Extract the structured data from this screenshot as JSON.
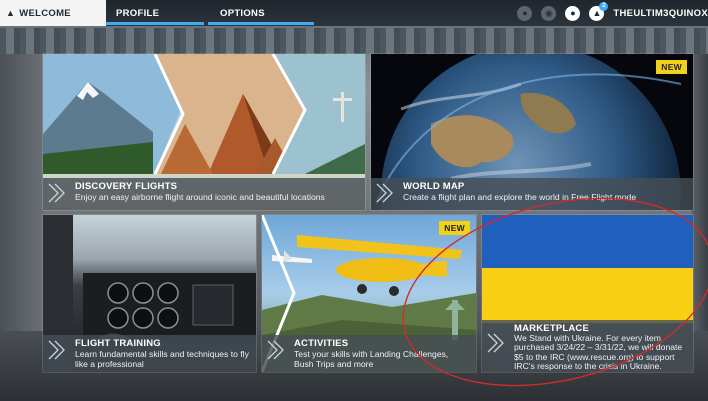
{
  "nav": {
    "tabs": [
      {
        "label": "WELCOME",
        "active": true
      },
      {
        "label": "PROFILE",
        "active": false
      },
      {
        "label": "OPTIONS",
        "active": false
      }
    ],
    "username": "THEULTIM3QUINOX",
    "notification_count": "2",
    "icons": [
      "globe-icon",
      "friends-icon",
      "user-icon",
      "notifications-icon"
    ]
  },
  "tiles": {
    "discovery": {
      "title": "DISCOVERY FLIGHTS",
      "description": "Enjoy an easy airborne flight around iconic and beautiful locations"
    },
    "world": {
      "title": "WORLD MAP",
      "description": "Create a flight plan and explore the world in Free Flight mode",
      "badge": "NEW"
    },
    "training": {
      "title": "FLIGHT TRAINING",
      "description": "Learn fundamental skills and techniques to fly like a professional"
    },
    "activities": {
      "title": "ACTIVITIES",
      "description": "Test your skills with Landing Challenges, Bush Trips and more",
      "badge": "NEW"
    },
    "marketplace": {
      "title": "MARKETPLACE",
      "description": "We Stand with Ukraine. For every item purchased 3/24/22 – 3/31/22, we will donate $5 to the IRC (www.rescue.org) to support IRC's response to the crisis in Ukraine."
    }
  },
  "colors": {
    "accent": "#3fa9f5",
    "badge": "#f1d11a",
    "flag_blue": "#1f5fbd",
    "flag_yellow": "#f9cf13",
    "annotation": "#d22a2a"
  }
}
